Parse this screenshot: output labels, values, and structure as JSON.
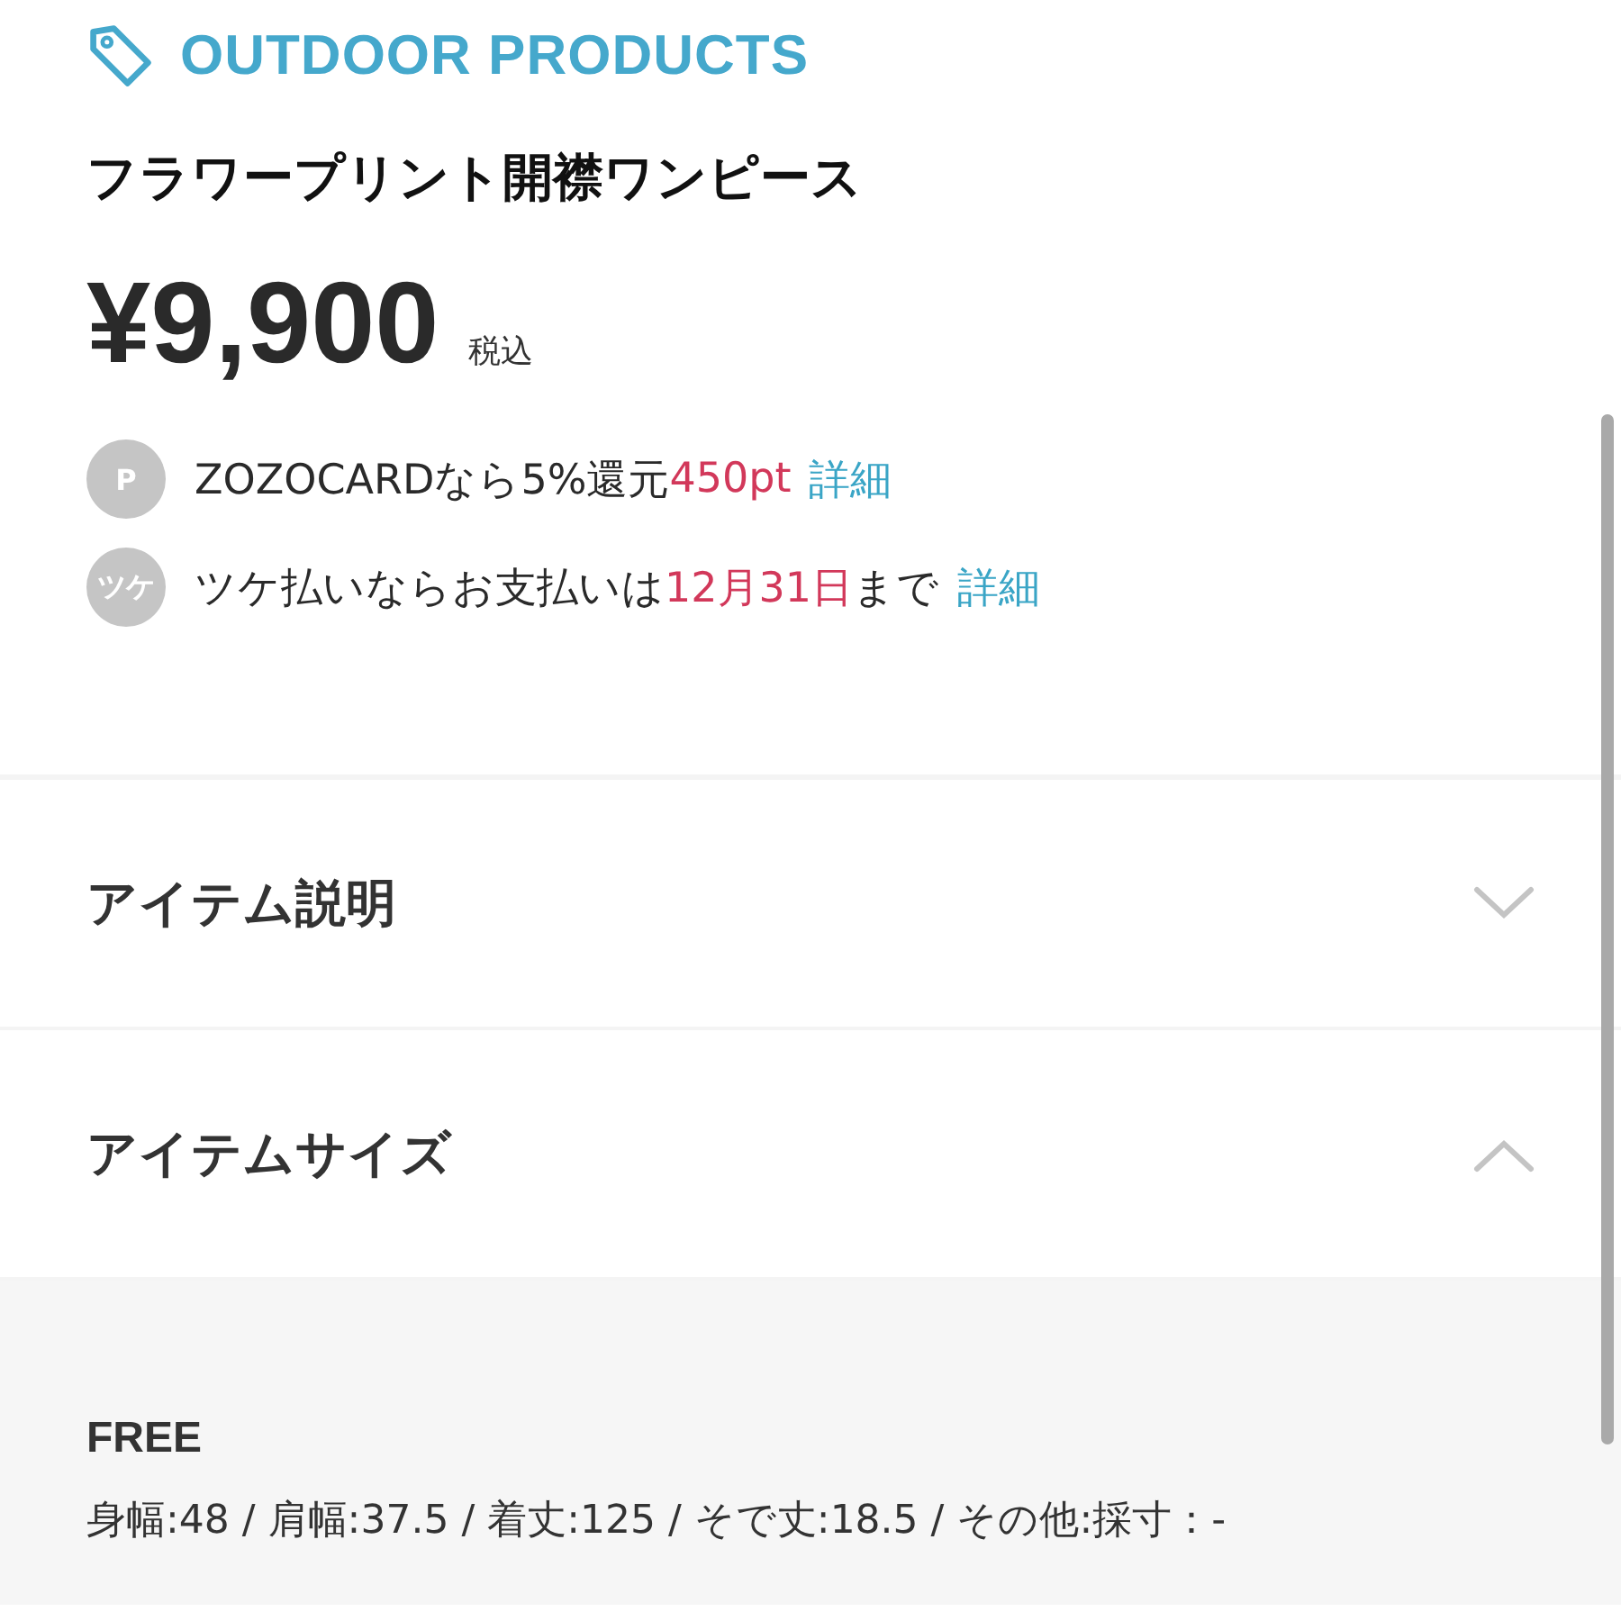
{
  "brand": "OUTDOOR PRODUCTS",
  "product_name": "フラワープリント開襟ワンピース",
  "price": {
    "amount": "¥9,900",
    "tax_note": "税込"
  },
  "benefits": [
    {
      "badge": "P",
      "parts": [
        {
          "kind": "plain",
          "text": "ZOZOCARDなら5%還元"
        },
        {
          "kind": "highlight",
          "text": "450pt"
        },
        {
          "kind": "link",
          "text": "詳細"
        }
      ]
    },
    {
      "badge": "ツケ",
      "parts": [
        {
          "kind": "plain",
          "text": "ツケ払いならお支払いは"
        },
        {
          "kind": "highlight",
          "text": "12月31日"
        },
        {
          "kind": "plain",
          "text": "まで"
        },
        {
          "kind": "link",
          "text": "詳細"
        }
      ]
    }
  ],
  "sections": [
    {
      "title": "アイテム説明",
      "expanded": false
    },
    {
      "title": "アイテムサイズ",
      "expanded": true,
      "content": {
        "size": "FREE",
        "measurements": "身幅:48 / 肩幅:37.5 / 着丈:125 / そで丈:18.5 / その他:採寸：-"
      }
    }
  ]
}
